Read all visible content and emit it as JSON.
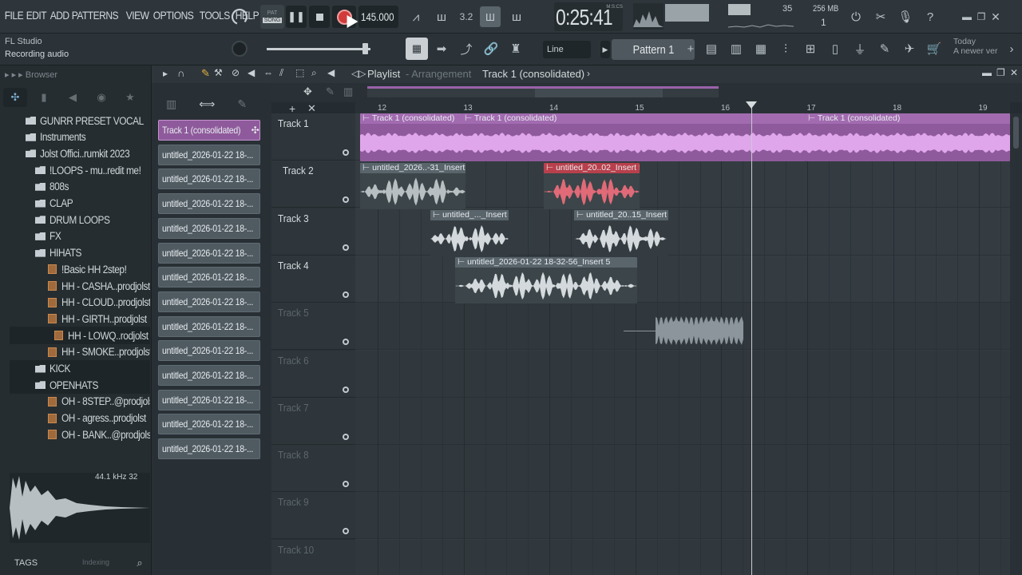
{
  "menu": [
    "FILE",
    "EDIT",
    "ADD",
    "PATTERNS",
    "VIEW",
    "OPTIONS",
    "TOOLS",
    "HELP"
  ],
  "transport": {
    "pat_label": "PAT",
    "song_label": "SONG",
    "tempo": "145.000",
    "time": "0:25:41",
    "time_unit": "M:S:CS",
    "cpu_value": "35",
    "memory": "256 MB",
    "voices": "1"
  },
  "status": {
    "app": "FL Studio",
    "message": "Recording audio"
  },
  "toolbar2": {
    "snap": "Line",
    "pattern": "Pattern 1",
    "news_title": "Today",
    "news_sub": "A newer versi..."
  },
  "browser": {
    "title": "Browser",
    "items": [
      {
        "label": "GUNRR PRESET VOCAL",
        "type": "folder"
      },
      {
        "label": "Instruments",
        "type": "folder"
      },
      {
        "label": "Jolst Offici..rumkit 2023",
        "type": "folder"
      },
      {
        "label": "!LOOPS - mu..redit me!",
        "type": "folder"
      },
      {
        "label": "808s",
        "type": "folder"
      },
      {
        "label": "CLAP",
        "type": "folder"
      },
      {
        "label": "DRUM LOOPS",
        "type": "folder"
      },
      {
        "label": "FX",
        "type": "folder"
      },
      {
        "label": "HIHATS",
        "type": "folder"
      },
      {
        "label": "!Basic HH 2step!",
        "type": "file"
      },
      {
        "label": "HH - CASHA..prodjolst",
        "type": "file"
      },
      {
        "label": "HH - CLOUD..prodjolst",
        "type": "file"
      },
      {
        "label": "HH - GIRTH..prodjolst",
        "type": "file"
      },
      {
        "label": "HH - LOWQ..rodjolst",
        "type": "file"
      },
      {
        "label": "HH - SMOKE..prodjolst",
        "type": "file"
      },
      {
        "label": "KICK",
        "type": "folder"
      },
      {
        "label": "OPENHATS",
        "type": "folder"
      },
      {
        "label": "OH - 8STEP..@prodjolst",
        "type": "file"
      },
      {
        "label": "OH - agress..prodjolst",
        "type": "file"
      },
      {
        "label": "OH - BANK..@prodjolst",
        "type": "file"
      }
    ],
    "sample_rate": "44.1 kHz 32",
    "tags_label": "TAGS",
    "indexing_label": "Indexing"
  },
  "channels": [
    "Track 1 (consolidated)",
    "untitled_2026-01-22 18-...",
    "untitled_2026-01-22 18-...",
    "untitled_2026-01-22 18-...",
    "untitled_2026-01-22 18-...",
    "untitled_2026-01-22 18-...",
    "untitled_2026-01-22 18-...",
    "untitled_2026-01-22 18-...",
    "untitled_2026-01-22 18-...",
    "untitled_2026-01-22 18-...",
    "untitled_2026-01-22 18-...",
    "untitled_2026-01-22 18-...",
    "untitled_2026-01-22 18-...",
    "untitled_2026-01-22 18-..."
  ],
  "playlist": {
    "title": "Playlist",
    "subtitle": "Arrangement",
    "crumb": "Track 1 (consolidated)",
    "bars": [
      "12",
      "13",
      "14",
      "15",
      "16",
      "17",
      "18",
      "19"
    ],
    "tracks": [
      "Track 1",
      "Track 2",
      "Track 3",
      "Track 4",
      "Track 5",
      "Track 6",
      "Track 7",
      "Track 8",
      "Track 9",
      "Track 10"
    ],
    "clips": {
      "t1a": "Track 1 (consolidated)",
      "t1b": "Track 1 (consolidated)",
      "t1c": "Track 1 (consolidated)",
      "t2a": "untitled_2026..-31_Insert 5",
      "t2b": "untitled_20..02_Insert 5",
      "t3a": "untitled_..._Insert 5",
      "t3b": "untitled_20..15_Insert 5",
      "t4a": "untitled_2026-01-22 18-32-56_Insert 5"
    }
  },
  "colors": {
    "accent_purple": "#9a62a8",
    "record_red": "#d23b3b",
    "clip_red": "#b8404c",
    "clip_gray": "#59646b"
  }
}
